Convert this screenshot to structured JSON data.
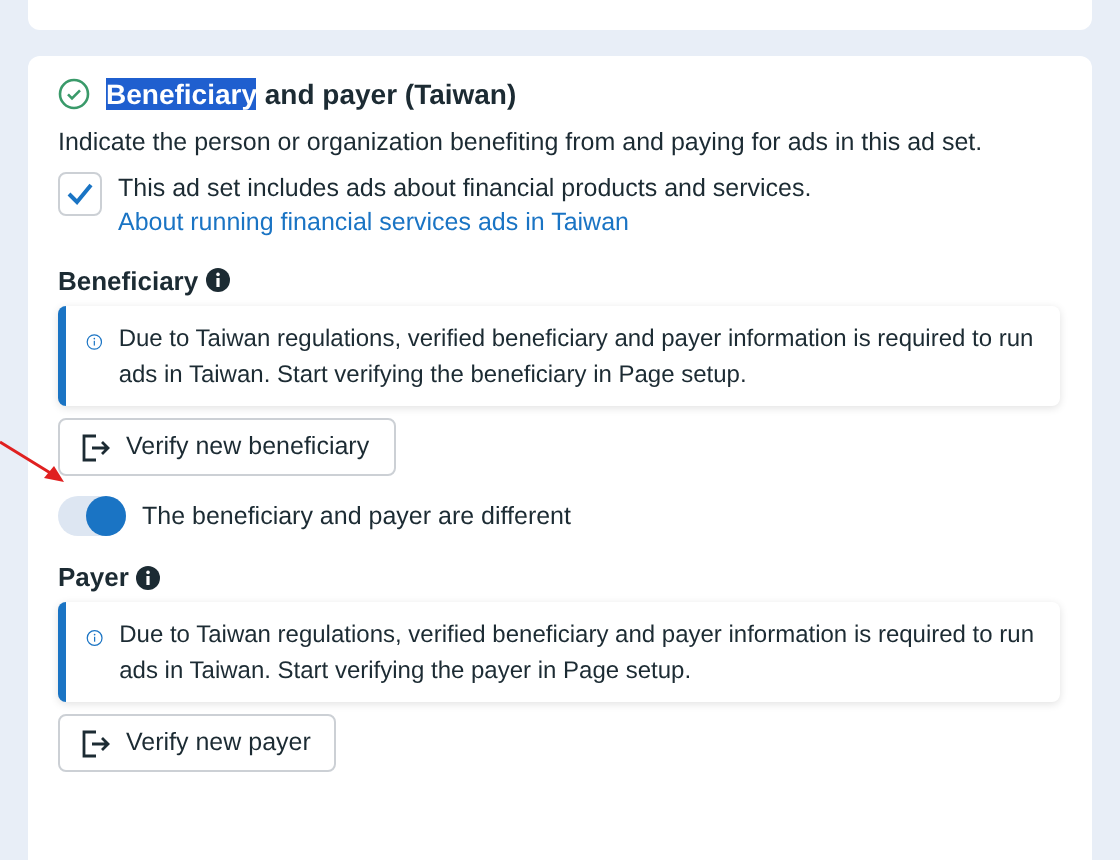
{
  "heading": {
    "parts": [
      {
        "text": "Beneficiary",
        "selected": true
      },
      {
        "text": "and payer (Taiwan)",
        "selected": false
      }
    ],
    "complete": true
  },
  "description": "Indicate the person or organization benefiting from and paying for ads in this ad set.",
  "checkbox": {
    "label": "This ad set includes ads about financial products and services.",
    "checked": true,
    "link": "About running financial services ads in Taiwan"
  },
  "blocks": [
    {
      "kind": "section",
      "label": "Beneficiary",
      "notice": "Due to Taiwan regulations, verified beneficiary and payer information is required to run ads in Taiwan. Start verifying the beneficiary in Page setup.",
      "button": "Verify new beneficiary"
    },
    {
      "kind": "toggle",
      "label": "The beneficiary and payer are different",
      "on": true
    },
    {
      "kind": "section",
      "label": "Payer",
      "notice": "Due to Taiwan regulations, verified beneficiary and payer information is required to run ads in Taiwan. Start verifying the payer in Page setup.",
      "button": "Verify new payer"
    }
  ]
}
